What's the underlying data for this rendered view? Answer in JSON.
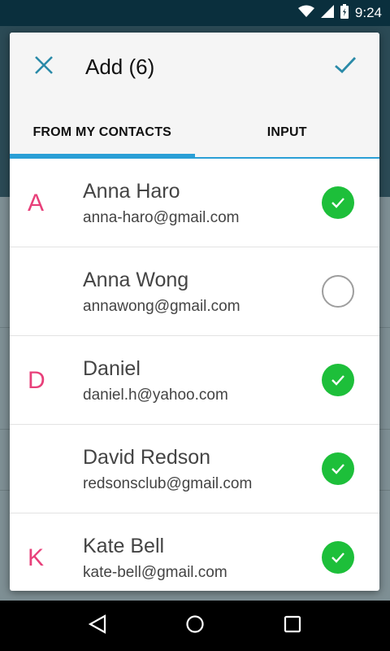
{
  "status_bar": {
    "time": "9:24",
    "icons": [
      "wifi-icon",
      "signal-icon",
      "battery-icon"
    ]
  },
  "dialog": {
    "title": "Add (6)",
    "close_icon": "close-icon",
    "confirm_icon": "check-icon",
    "tabs": [
      {
        "label": "FROM MY CONTACTS",
        "active": true
      },
      {
        "label": "INPUT",
        "active": false
      }
    ],
    "contacts": [
      {
        "letter": "A",
        "name": "Anna Haro",
        "email": "anna-haro@gmail.com",
        "selected": true
      },
      {
        "letter": "",
        "name": "Anna Wong",
        "email": "annawong@gmail.com",
        "selected": false
      },
      {
        "letter": "D",
        "name": "Daniel",
        "email": "daniel.h@yahoo.com",
        "selected": true
      },
      {
        "letter": "",
        "name": "David Redson",
        "email": "redsonsclub@gmail.com",
        "selected": true
      },
      {
        "letter": "K",
        "name": "Kate Bell",
        "email": "kate-bell@gmail.com",
        "selected": true
      }
    ]
  },
  "nav_bar": {
    "buttons": [
      "back-icon",
      "home-icon",
      "recents-icon"
    ]
  },
  "colors": {
    "accent": "#2a9fd6",
    "check_green": "#1dbf3a",
    "section_letter": "#e8407a",
    "icon_teal": "#2a8aa8"
  }
}
